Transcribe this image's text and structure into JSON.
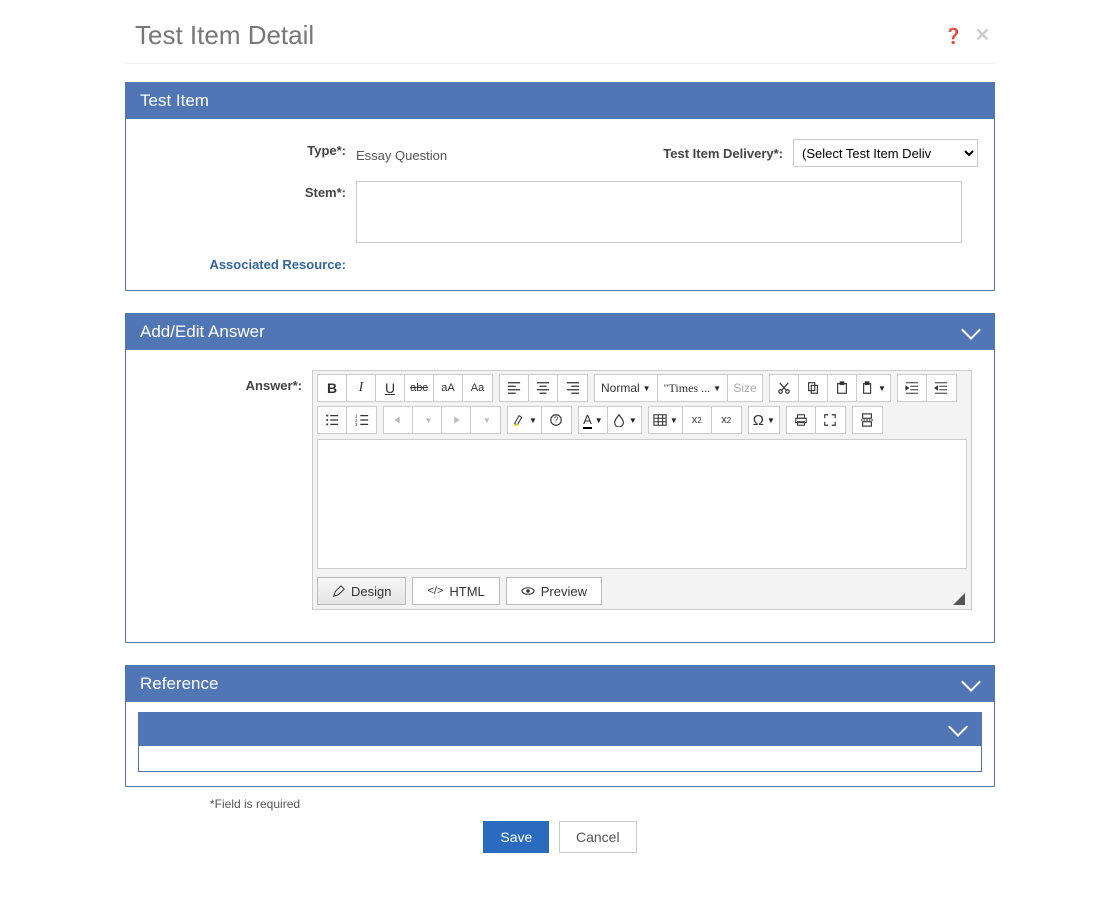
{
  "page": {
    "title": "Test Item Detail"
  },
  "panels": {
    "item": {
      "title": "Test Item"
    },
    "answer": {
      "title": "Add/Edit Answer"
    },
    "reference": {
      "title": "Reference"
    }
  },
  "form": {
    "type_label": "Type*:",
    "type_value": "Essay Question",
    "delivery_label": "Test Item Delivery*:",
    "delivery_selected": "(Select Test Item Deliv",
    "stem_label": "Stem*:",
    "stem_value": "",
    "associated_resource": "Associated Resource:"
  },
  "answer": {
    "label": "Answer*:",
    "toolbar": {
      "bold": "B",
      "italic": "I",
      "underline": "U",
      "strike": "abc",
      "case_upper": "aA",
      "case_title": "Aa",
      "format_normal": "Normal",
      "font": "\"Times ...",
      "size": "Size",
      "omega": "Ω",
      "font_color": "A"
    },
    "tabs": {
      "design": "Design",
      "html": "HTML",
      "preview": "Preview"
    }
  },
  "footer": {
    "required_note": "*Field is required",
    "save": "Save",
    "cancel": "Cancel"
  }
}
